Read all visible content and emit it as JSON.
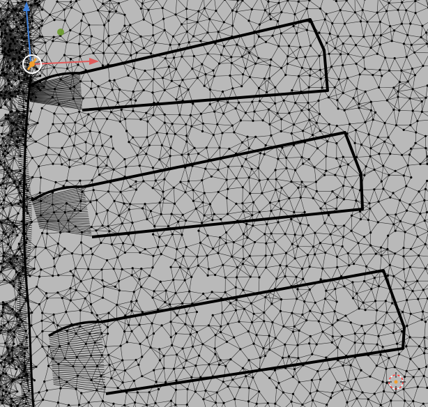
{
  "viewport": {
    "background_color": "#b9b9b9",
    "face_color": "#bdbdbd",
    "edge_color": "#111111",
    "vertex_color": "#000000"
  },
  "gizmo": {
    "x_axis_color": "#e05a5a",
    "y_axis_color": "#6a9b2a",
    "z_axis_color": "#3d7fd9",
    "origin_color": "#f0a030",
    "ring_color": "#ffffff"
  },
  "cursor_3d": {
    "ring_colors": [
      "#ff3b3b",
      "#ffffff"
    ],
    "center_color": "#f0a030"
  },
  "icons": {
    "transform_gizmo": "transform-gizmo-icon",
    "cursor": "3d-cursor-icon"
  }
}
